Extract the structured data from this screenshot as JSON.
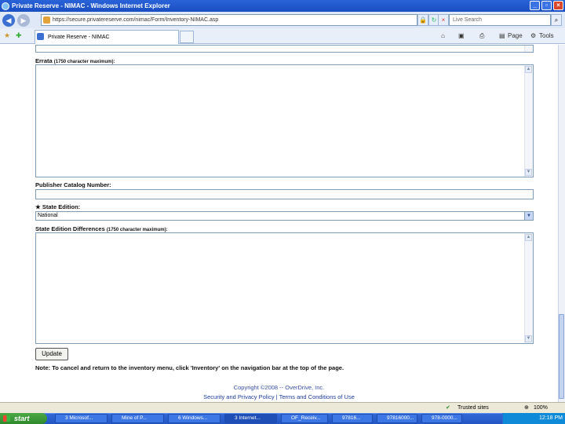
{
  "window": {
    "title": "Private Reserve - NIMAC - Windows Internet Explorer"
  },
  "address": {
    "url": "https://secure.privatereserve.com/nimac/Form/Inventory-NIMAC.asp"
  },
  "search": {
    "placeholder": "Live Search"
  },
  "tab": {
    "label": "Private Reserve - NIMAC"
  },
  "commandbar": {
    "page": "Page",
    "tools": "Tools"
  },
  "form": {
    "errata_label": "Errata",
    "errata_hint": "(1750 character maximum):",
    "catalog_label": "Publisher Catalog Number:",
    "state_edition_label": "State Edition:",
    "state_edition_star": "★",
    "state_edition_value": "National",
    "differences_label": "State Edition Differences",
    "differences_hint": "(1750 character maximum):",
    "update_button": "Update",
    "note": "Note: To cancel and return to the inventory menu, click 'Inventory' on the navigation bar at the top of the page."
  },
  "footer": {
    "copyright": "Copyright ©2008 -- OverDrive, Inc.",
    "security_link": "Security and Privacy Policy",
    "separator": "|",
    "terms_link": "Terms and Conditions of Use"
  },
  "statusbar": {
    "zone": "Trusted sites",
    "zoom": "100%"
  },
  "taskbar": {
    "start": "start",
    "tasks": [
      "3 Microsof...",
      "Mine of P...",
      "6 Windows...",
      "3 Internet...",
      "OF_Receiv...",
      "97816...",
      "97816000...",
      "978-0000..."
    ],
    "clock": "12:18 PM"
  }
}
